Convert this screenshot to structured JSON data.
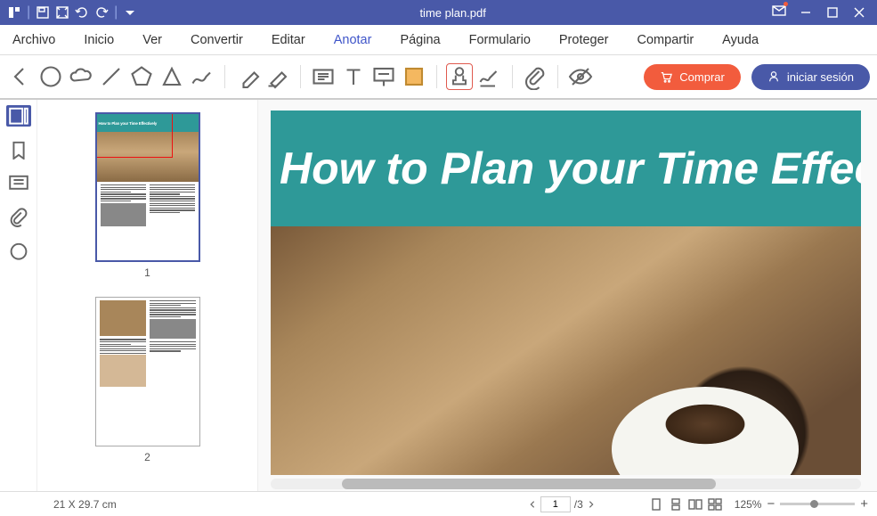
{
  "title_bar": {
    "title": "time plan.pdf"
  },
  "menu": {
    "items": [
      "Archivo",
      "Inicio",
      "Ver",
      "Convertir",
      "Editar",
      "Anotar",
      "Página",
      "Formulario",
      "Proteger",
      "Compartir",
      "Ayuda"
    ],
    "active_index": 5
  },
  "toolbar": {
    "buy_label": "Comprar",
    "login_label": "iniciar sesión"
  },
  "thumbnails": {
    "page1_label": "1",
    "page2_label": "2",
    "page1_banner": "How to Plan your Time Effectively"
  },
  "document": {
    "banner_text": "How to Plan your Time Effectivel"
  },
  "bottom": {
    "dimensions": "21 X 29.7 cm",
    "current_page": "1",
    "total_pages": "/3",
    "zoom": "125%"
  }
}
